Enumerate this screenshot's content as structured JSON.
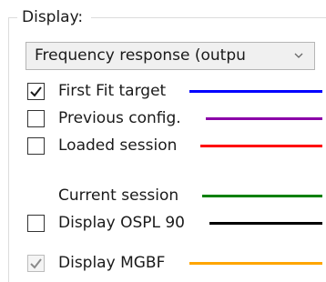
{
  "group": {
    "label": "Display:"
  },
  "display_select": {
    "value": "Frequency response (outpu",
    "arrow_icon": "chevron-down-icon"
  },
  "options": [
    {
      "label": "First Fit target",
      "checked": true,
      "enabled": true,
      "has_checkbox": true,
      "color": "#0000ff"
    },
    {
      "label": "Previous config.",
      "checked": false,
      "enabled": true,
      "has_checkbox": true,
      "color": "#8b00a8"
    },
    {
      "label": "Loaded session",
      "checked": false,
      "enabled": true,
      "has_checkbox": true,
      "color": "#ff0000"
    },
    {
      "label": "Current session",
      "checked": false,
      "enabled": true,
      "has_checkbox": false,
      "color": "#008000"
    },
    {
      "label": "Display OSPL 90",
      "checked": false,
      "enabled": true,
      "has_checkbox": true,
      "color": "#000000"
    },
    {
      "label": "Display MGBF",
      "checked": true,
      "enabled": false,
      "has_checkbox": true,
      "color": "#ffa500"
    }
  ]
}
